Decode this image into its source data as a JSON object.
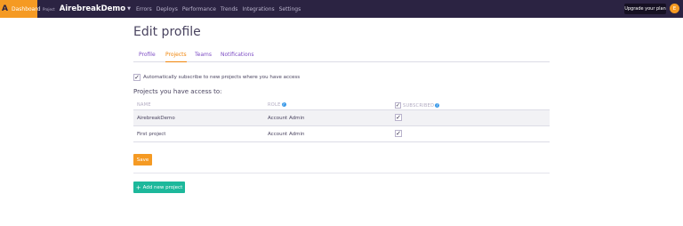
{
  "topbar": {
    "logo_letter": "A",
    "dashboard_label": "Dashboard",
    "project_small_label": "Project",
    "project_name": "AirebreakDemo",
    "nav": [
      "Errors",
      "Deploys",
      "Performance",
      "Trends",
      "Integrations",
      "Settings"
    ],
    "upgrade_label": "Upgrade your plan",
    "avatar_initial": "E"
  },
  "page": {
    "title": "Edit profile",
    "tabs": [
      {
        "label": "Profile",
        "active": false
      },
      {
        "label": "Projects",
        "active": true
      },
      {
        "label": "Teams",
        "active": false
      },
      {
        "label": "Notifications",
        "active": false
      }
    ],
    "auto_subscribe_label": "Automatically subscribe to new projects where you have access",
    "auto_subscribe_checked": true,
    "subtitle": "Projects you have access to:"
  },
  "table": {
    "headers": {
      "name": "NAME",
      "role": "ROLE",
      "subscribed": "SUBSCRIBED"
    },
    "rows": [
      {
        "name": "AirebreakDemo",
        "role": "Account Admin",
        "subscribed": true
      },
      {
        "name": "First project",
        "role": "Account Admin",
        "subscribed": true
      }
    ]
  },
  "buttons": {
    "save": "Save",
    "add_project": "Add new project"
  },
  "colors": {
    "topbar": "#2b2342",
    "accent_orange": "#f59a23",
    "accent_green": "#1db89b",
    "link_purple": "#7d4cc4"
  }
}
